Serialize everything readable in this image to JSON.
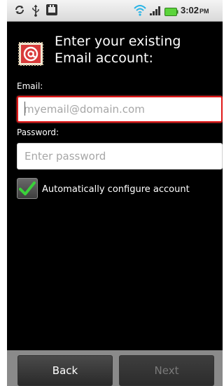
{
  "status_bar": {
    "time": "3:02",
    "ampm": "PM",
    "icons": [
      "sync-icon",
      "usb-icon",
      "app-notification-icon",
      "wifi-icon",
      "signal-icon",
      "battery-icon"
    ]
  },
  "header": {
    "title": "Enter your existing Email account:",
    "icon": "email-app-icon"
  },
  "form": {
    "email_label": "Email:",
    "email_placeholder": "myemail@domain.com",
    "email_value": "",
    "password_label": "Password:",
    "password_placeholder": "Enter password",
    "password_value": "",
    "auto_configure_label": "Automatically configure account",
    "auto_configure_checked": true
  },
  "buttons": {
    "back_label": "Back",
    "next_label": "Next",
    "next_enabled": false
  },
  "colors": {
    "focus_border": "#e01818",
    "check_green": "#3ad13a",
    "background": "#000000"
  }
}
